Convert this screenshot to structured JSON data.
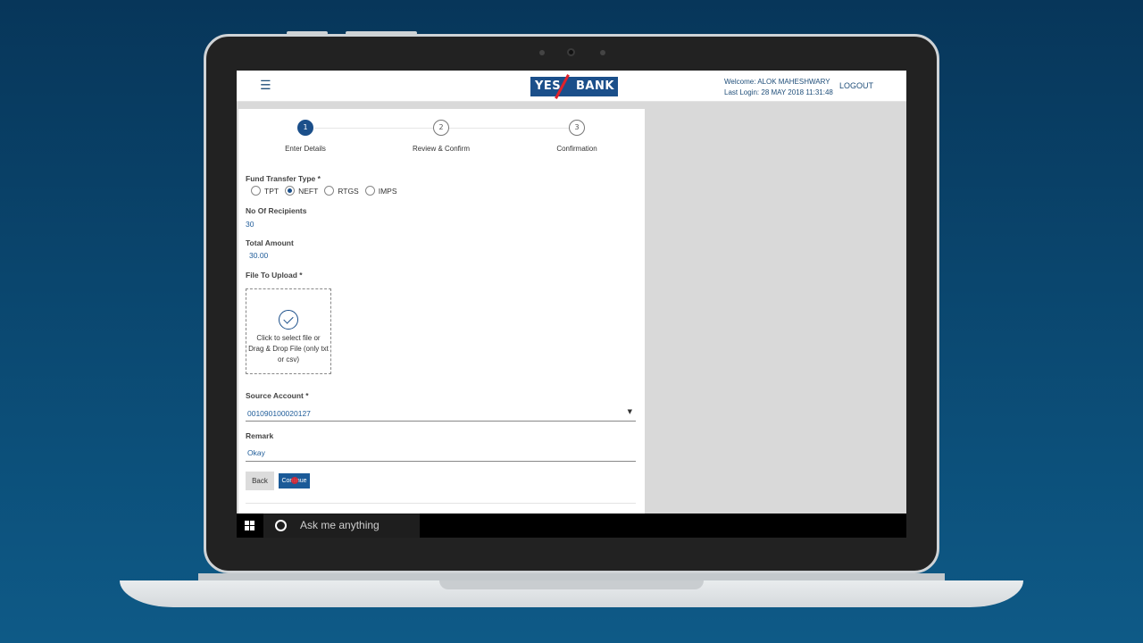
{
  "header": {
    "logo": {
      "left": "YES",
      "right": "BANK"
    },
    "welcome_line": "Welcome: ALOK MAHESHWARY",
    "last_login_line": "Last Login: 28 MAY 2018 11:31:48",
    "logout_label": "LOGOUT"
  },
  "steps": [
    {
      "number": "1",
      "label": "Enter Details",
      "active": true
    },
    {
      "number": "2",
      "label": "Review & Confirm",
      "active": false
    },
    {
      "number": "3",
      "label": "Confirmation",
      "active": false
    }
  ],
  "form": {
    "fund_transfer_type": {
      "label": "Fund Transfer Type *",
      "options": [
        "TPT",
        "NEFT",
        "RTGS",
        "IMPS"
      ],
      "selected": "NEFT"
    },
    "no_of_recipients": {
      "label": "No Of Recipients",
      "value": "30"
    },
    "total_amount": {
      "label": "Total Amount",
      "value": "30.00"
    },
    "file_to_upload": {
      "label": "File To Upload *",
      "dropzone_text": "Click to select file or Drag & Drop File (only txt or csv)"
    },
    "source_account": {
      "label": "Source Account *",
      "value": "001090100020127"
    },
    "remark": {
      "label": "Remark",
      "value": "Okay"
    }
  },
  "buttons": {
    "back_label": "Back",
    "continue_label": "Continue"
  },
  "taskbar": {
    "search_placeholder": "Ask me anything"
  },
  "colors": {
    "brand_blue": "#1b4f8a",
    "brand_red": "#e0222b",
    "background_navy": "#07365a"
  }
}
